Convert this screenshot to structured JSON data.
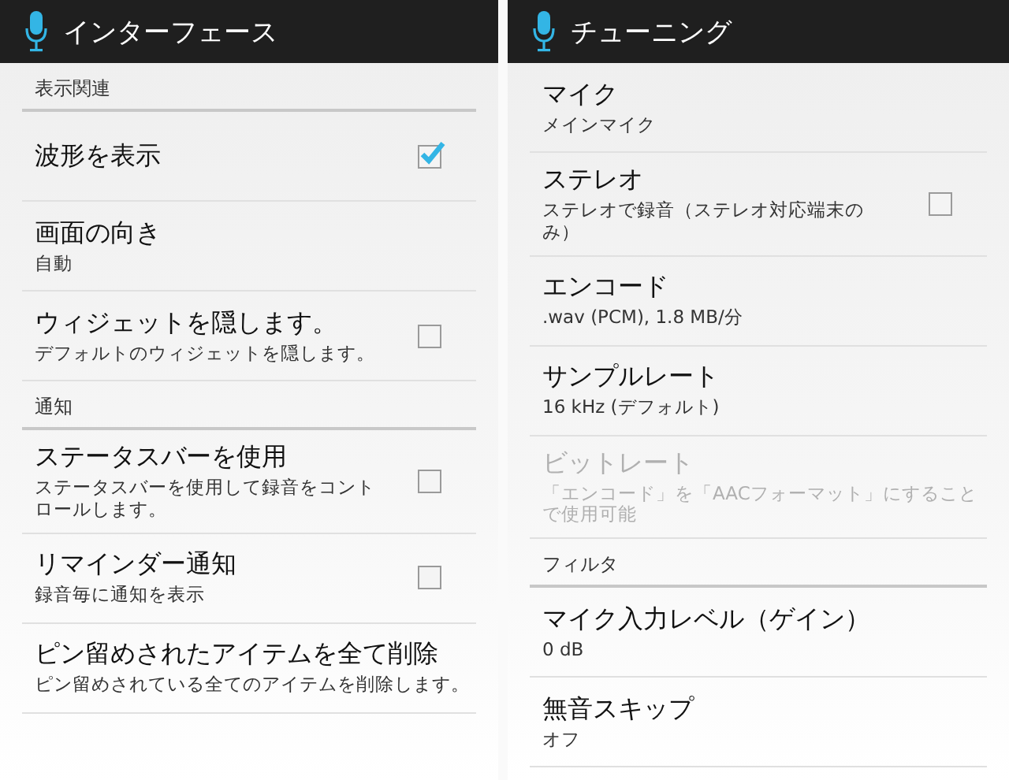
{
  "screens": [
    {
      "title": "インターフェース",
      "entries": [
        {
          "kind": "category",
          "label": "表示関連"
        },
        {
          "kind": "checkbox",
          "title": "波形を表示",
          "checked": true,
          "disabled": false
        },
        {
          "kind": "text",
          "title": "画面の向き",
          "summary": "自動",
          "disabled": false
        },
        {
          "kind": "checkbox",
          "title": "ウィジェットを隠します。",
          "summary": "デフォルトのウィジェットを隠します。",
          "checked": false,
          "disabled": false
        },
        {
          "kind": "category",
          "label": "通知"
        },
        {
          "kind": "checkbox",
          "title": "ステータスバーを使用",
          "summary": "ステータスバーを使用して録音をコントロールします。",
          "checked": false,
          "disabled": false
        },
        {
          "kind": "checkbox",
          "title": "リマインダー通知",
          "summary": "録音毎に通知を表示",
          "checked": false,
          "disabled": false
        },
        {
          "kind": "text",
          "title": "ピン留めされたアイテムを全て削除",
          "summary": "ピン留めされている全てのアイテムを削除します。",
          "disabled": false
        }
      ]
    },
    {
      "title": "チューニング",
      "entries": [
        {
          "kind": "text",
          "title": "マイク",
          "summary": "メインマイク",
          "disabled": false
        },
        {
          "kind": "checkbox",
          "title": "ステレオ",
          "summary": "ステレオで録音（ステレオ対応端末のみ）",
          "checked": false,
          "disabled": false
        },
        {
          "kind": "text",
          "title": "エンコード",
          "summary": ".wav (PCM), 1.8 MB/分",
          "disabled": false
        },
        {
          "kind": "text",
          "title": "サンプルレート",
          "summary": "16 kHz (デフォルト)",
          "disabled": false
        },
        {
          "kind": "text",
          "title": "ビットレート",
          "summary": "「エンコード」を「AACフォーマット」にすることで使用可能",
          "disabled": true
        },
        {
          "kind": "category",
          "label": "フィルタ"
        },
        {
          "kind": "text",
          "title": "マイク入力レベル（ゲイン）",
          "summary": "0 dB",
          "disabled": false
        },
        {
          "kind": "text",
          "title": "無音スキップ",
          "summary": "オフ",
          "disabled": false
        }
      ]
    }
  ]
}
